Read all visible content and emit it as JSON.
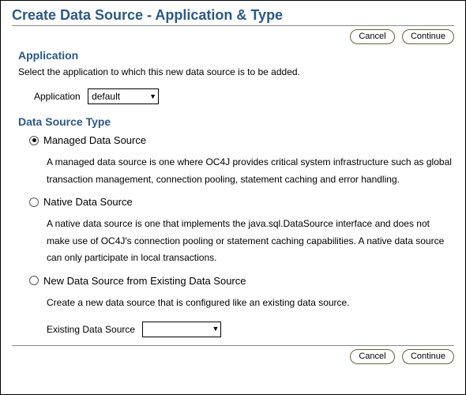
{
  "title": "Create Data Source - Application & Type",
  "buttons": {
    "cancel": "Cancel",
    "continue": "Continue"
  },
  "application_section": {
    "heading": "Application",
    "description": "Select the application to which this new data source is to be added.",
    "field_label": "Application",
    "selected_value": "default"
  },
  "type_section": {
    "heading": "Data Source Type",
    "options": [
      {
        "label": "Managed Data Source",
        "description": "A managed data source is one where OC4J provides critical system infrastructure such as global transaction management, connection pooling, statement caching and error handling.",
        "selected": true
      },
      {
        "label": "Native Data Source",
        "description": "A native data source is one that implements the java.sql.DataSource interface and does not make use of OC4J's connection pooling or statement caching capabilities. A native data source can only participate in local transactions.",
        "selected": false
      },
      {
        "label": "New Data Source from Existing Data Source",
        "description": "Create a new data source that is configured like an existing data source.",
        "selected": false,
        "sub_field_label": "Existing Data Source",
        "sub_field_value": ""
      }
    ]
  }
}
